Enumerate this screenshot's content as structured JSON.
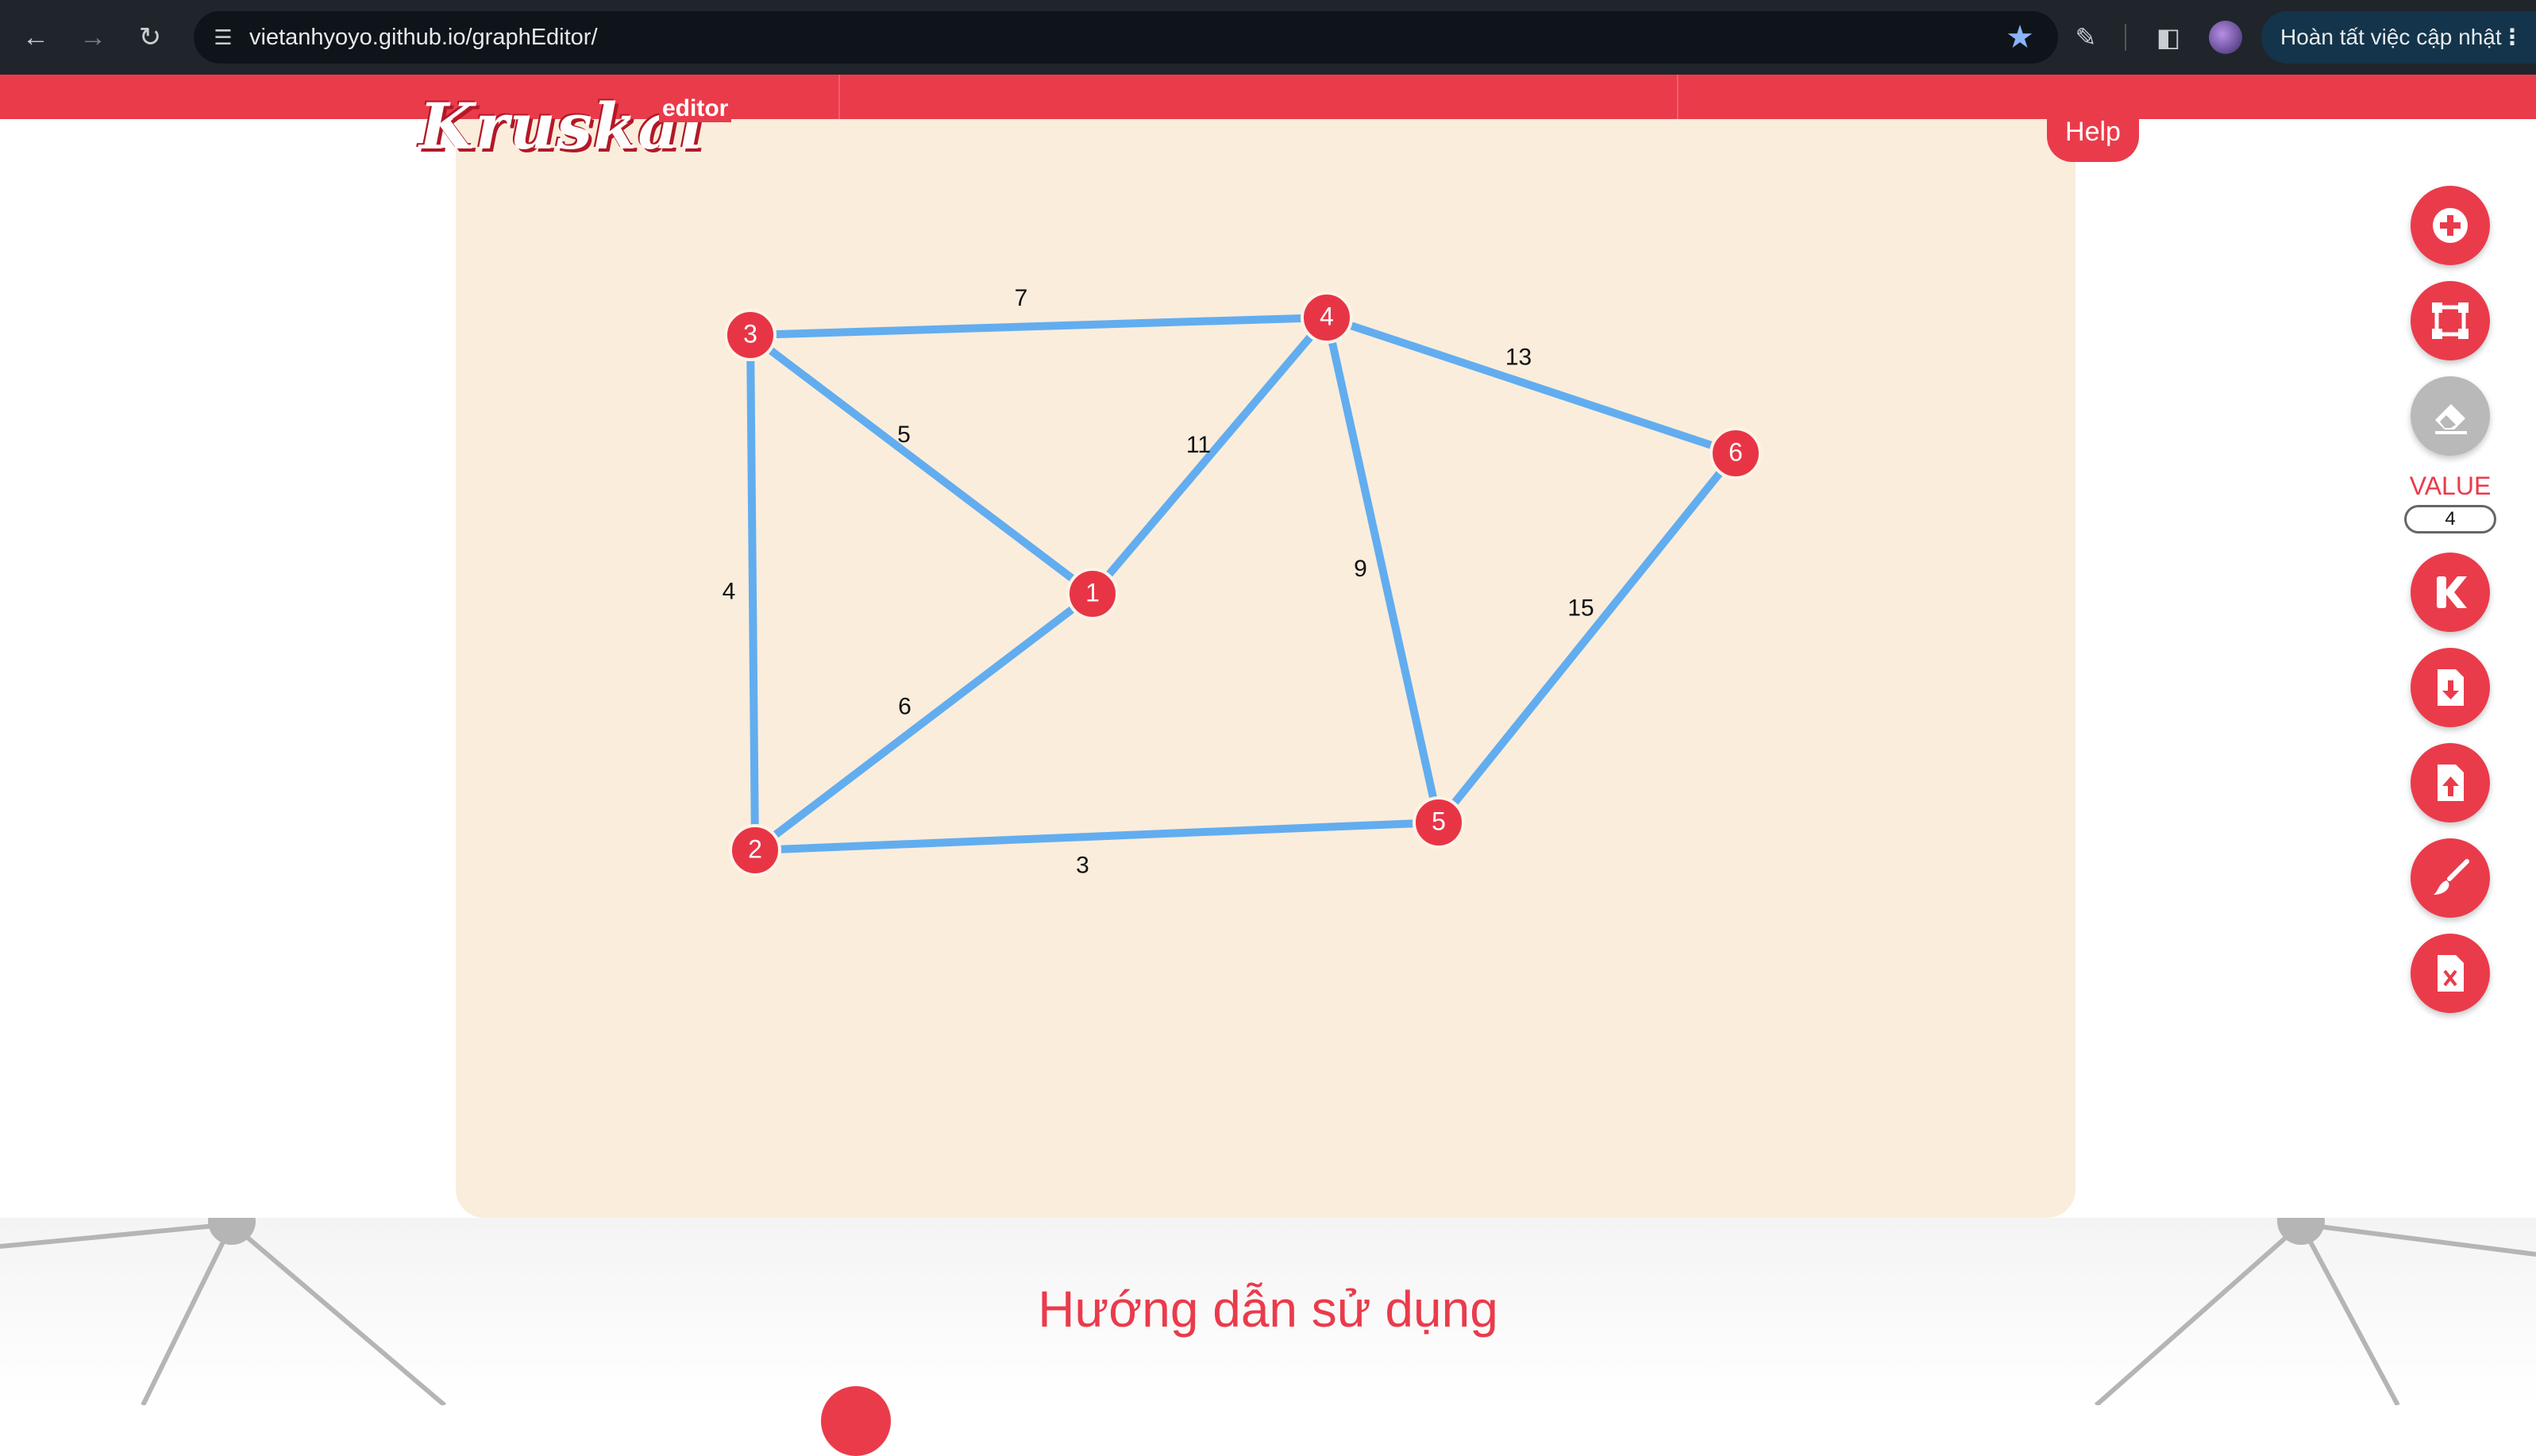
{
  "browser": {
    "url": "vietanhyoyo.github.io/graphEditor/",
    "update_label": "Hoàn tất việc cập nhật",
    "back_icon": "arrow-left",
    "forward_icon": "arrow-right",
    "reload_icon": "reload",
    "site_info_icon": "tune",
    "bookmark_icon": "star",
    "extensions_icon": "puzzle",
    "sidepanel_icon": "side-panel",
    "menu_icon": "kebab"
  },
  "app": {
    "logo": "Kruskal",
    "logo_sub": "editor",
    "help_label": "Help",
    "brand_color": "#ea3b4b",
    "edge_color": "#62adef",
    "canvas_color": "#faeddc"
  },
  "graph": {
    "nodes": [
      {
        "id": "1",
        "label": "1"
      },
      {
        "id": "2",
        "label": "2"
      },
      {
        "id": "3",
        "label": "3"
      },
      {
        "id": "4",
        "label": "4"
      },
      {
        "id": "5",
        "label": "5"
      },
      {
        "id": "6",
        "label": "6"
      }
    ],
    "edges": [
      {
        "from": "3",
        "to": "4",
        "weight": "7"
      },
      {
        "from": "3",
        "to": "1",
        "weight": "5"
      },
      {
        "from": "3",
        "to": "2",
        "weight": "4"
      },
      {
        "from": "1",
        "to": "4",
        "weight": "11"
      },
      {
        "from": "1",
        "to": "2",
        "weight": "6"
      },
      {
        "from": "4",
        "to": "6",
        "weight": "13"
      },
      {
        "from": "4",
        "to": "5",
        "weight": "9"
      },
      {
        "from": "6",
        "to": "5",
        "weight": "15"
      },
      {
        "from": "2",
        "to": "5",
        "weight": "3"
      }
    ]
  },
  "toolbar": {
    "value_label": "VALUE",
    "value": "4",
    "tools": [
      {
        "name": "add-node",
        "icon": "plus-circle-icon",
        "active": true
      },
      {
        "name": "add-edge",
        "icon": "vector-square-icon",
        "active": true
      },
      {
        "name": "erase",
        "icon": "eraser-icon",
        "active": false
      },
      {
        "name": "kruskal",
        "icon": "k-letter-icon",
        "active": true
      },
      {
        "name": "download",
        "icon": "file-download-icon",
        "active": true
      },
      {
        "name": "upload",
        "icon": "file-upload-icon",
        "active": true
      },
      {
        "name": "brush",
        "icon": "brush-icon",
        "active": true
      },
      {
        "name": "clear",
        "icon": "file-excel-icon",
        "active": true
      }
    ]
  },
  "footer": {
    "section_title": "Hướng dẫn sử dụng"
  }
}
